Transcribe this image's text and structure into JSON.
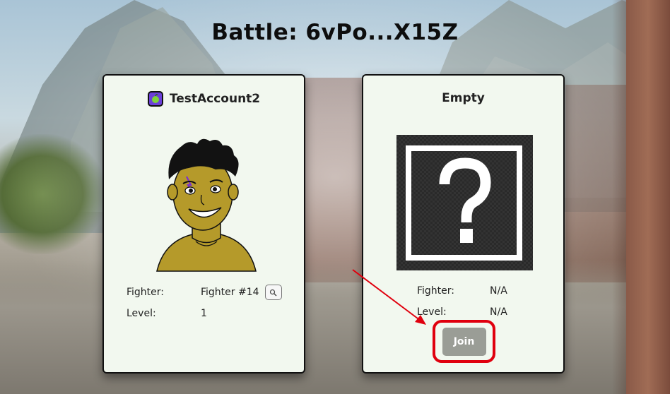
{
  "page": {
    "title": "Battle: 6vPo...X15Z"
  },
  "player_one": {
    "name": "TestAccount2",
    "avatar_icon": "apple-icon",
    "stats": [
      {
        "label": "Fighter:",
        "value": "Fighter #14"
      },
      {
        "label": "Level:",
        "value": "1"
      }
    ]
  },
  "player_two": {
    "name": "Empty",
    "placeholder_icon": "question-mark-icon",
    "stats": [
      {
        "label": "Fighter:",
        "value": "N/A"
      },
      {
        "label": "Level:",
        "value": "N/A"
      }
    ],
    "join_label": "Join"
  },
  "colors": {
    "card_bg": "#f2f8ef",
    "highlight": "#e0000e",
    "join_button": "#9a9d96",
    "app_icon_bg": "#6c3fd9"
  }
}
